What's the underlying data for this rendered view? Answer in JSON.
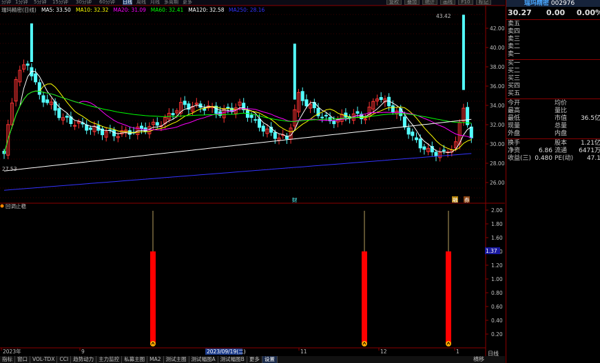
{
  "toolbar": {
    "periods": [
      "分钟",
      "1分钟",
      "5分钟",
      "15分钟",
      "30分钟",
      "60分钟",
      "日线",
      "周线",
      "月线",
      "多周期",
      "更多"
    ],
    "active_period": "日线",
    "right_buttons": [
      "复权",
      "叠加",
      "统计",
      "画线",
      "F10",
      "标记"
    ]
  },
  "indicators": {
    "title": "瑞玛精密(日线)",
    "ma": [
      {
        "text": "MA5: 33.50",
        "color": "#ffffff"
      },
      {
        "text": "MA10: 32.32",
        "color": "#ffff00"
      },
      {
        "text": "MA20: 31.09",
        "color": "#ff00ff"
      },
      {
        "text": "MA60: 32.41",
        "color": "#00ff00"
      },
      {
        "text": "MA120: 32.58",
        "color": "#ffffff"
      },
      {
        "text": "MA250: 28.16",
        "color": "#3333ff"
      }
    ]
  },
  "price_axis": [
    "42.00",
    "40.00",
    "38.00",
    "36.00",
    "34.00",
    "32.00",
    "30.00",
    "28.00",
    "26.00"
  ],
  "annotations": {
    "high": "43.42",
    "low": "27.53",
    "marker1": "财",
    "marker2": "融",
    "marker3": "券"
  },
  "sub": {
    "title": "回调止稳",
    "axis": [
      "2.00",
      "1.80",
      "1.60",
      "1.40",
      "1.20",
      "1.00",
      "0.80",
      "0.60",
      "0.40",
      "0.20"
    ],
    "current": "1.37"
  },
  "date_axis": [
    "2023年",
    "9",
    "2023/09/19(二)",
    "11",
    "12",
    "1"
  ],
  "bottom_tabs": [
    "指标",
    "窗口",
    "VOL-TDX",
    "CCI",
    "趋势动力",
    "主力监控",
    "私募主图",
    "MA2",
    "测试主图",
    "测试幅图A",
    "测试幅图B",
    "更多",
    "设置"
  ],
  "bottom_right": {
    "pan": "横移",
    "period": "日线"
  },
  "quote": {
    "name": "瑞玛精密",
    "code": "002976",
    "price": "30.27",
    "change": "0.00",
    "pct": "0.00%",
    "asks": [
      "卖五",
      "卖四",
      "卖三",
      "卖二",
      "卖一"
    ],
    "bids": [
      "买一",
      "买二",
      "买三",
      "买四",
      "买五"
    ],
    "stats": [
      {
        "k": "今开",
        "v": "",
        "k2": "均价",
        "v2": ""
      },
      {
        "k": "最高",
        "v": "",
        "k2": "量比",
        "v2": ""
      },
      {
        "k": "最低",
        "v": "",
        "k2": "市值",
        "v2": "36.5亿"
      },
      {
        "k": "现量",
        "v": "",
        "k2": "总量",
        "v2": ""
      },
      {
        "k": "外盘",
        "v": "",
        "k2": "内盘",
        "v2": ""
      }
    ],
    "fin": [
      {
        "k": "换手",
        "v": "",
        "k2": "股本",
        "v2": "1.21亿"
      },
      {
        "k": "净资",
        "v": "6.86",
        "k2": "流通",
        "v2": "6471万"
      },
      {
        "k": "收益(三)",
        "v": "0.480",
        "k2": "PE(动)",
        "v2": "47.1"
      }
    ]
  },
  "colors": {
    "up": "#ff3333",
    "down": "#54ffff",
    "bg": "#000000",
    "axis": "#8b0000",
    "signal": "#ff0000"
  }
}
